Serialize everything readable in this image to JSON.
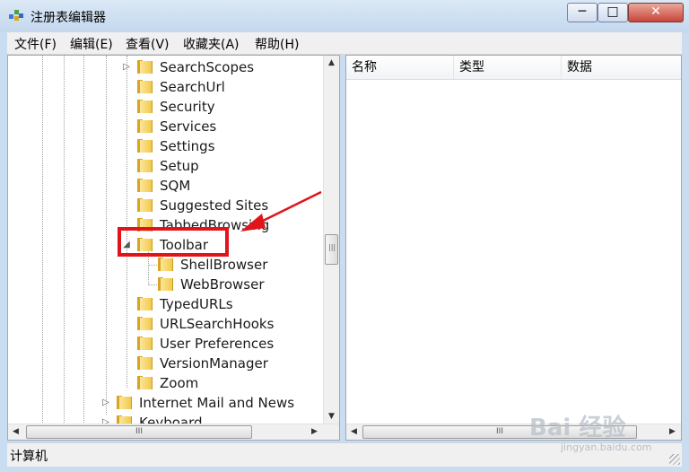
{
  "window": {
    "title": "注册表编辑器",
    "minimize": "─",
    "maximize": "□",
    "close": "✕"
  },
  "menu": [
    "文件(F)",
    "编辑(E)",
    "查看(V)",
    "收藏夹(A)",
    "帮助(H)"
  ],
  "tree": {
    "nodes": [
      {
        "label": "SearchScopes",
        "expander": "▷"
      },
      {
        "label": "SearchUrl",
        "expander": ""
      },
      {
        "label": "Security",
        "expander": ""
      },
      {
        "label": "Services",
        "expander": ""
      },
      {
        "label": "Settings",
        "expander": ""
      },
      {
        "label": "Setup",
        "expander": ""
      },
      {
        "label": "SQM",
        "expander": ""
      },
      {
        "label": "Suggested Sites",
        "expander": ""
      },
      {
        "label": "TabbedBrowsing",
        "expander": ""
      },
      {
        "label": "Toolbar",
        "expander": "◢"
      },
      {
        "label": "ShellBrowser",
        "expander": ""
      },
      {
        "label": "WebBrowser",
        "expander": ""
      },
      {
        "label": "TypedURLs",
        "expander": ""
      },
      {
        "label": "URLSearchHooks",
        "expander": ""
      },
      {
        "label": "User Preferences",
        "expander": ""
      },
      {
        "label": "VersionManager",
        "expander": ""
      },
      {
        "label": "Zoom",
        "expander": ""
      },
      {
        "label": "Internet Mail and News",
        "expander": "▷"
      },
      {
        "label": "Keyboard",
        "expander": "▷"
      }
    ]
  },
  "list": {
    "columns": [
      "名称",
      "类型",
      "数据"
    ]
  },
  "scroll": {
    "up": "▲",
    "down": "▼",
    "left": "◀",
    "right": "▶",
    "grip": "|||",
    "grip_h": "III"
  },
  "status": {
    "path": "计算机"
  },
  "watermark": {
    "brand": "Bai 经验",
    "url": "jingyan.baidu.com"
  },
  "annotation": {
    "color": "#e0141a"
  }
}
